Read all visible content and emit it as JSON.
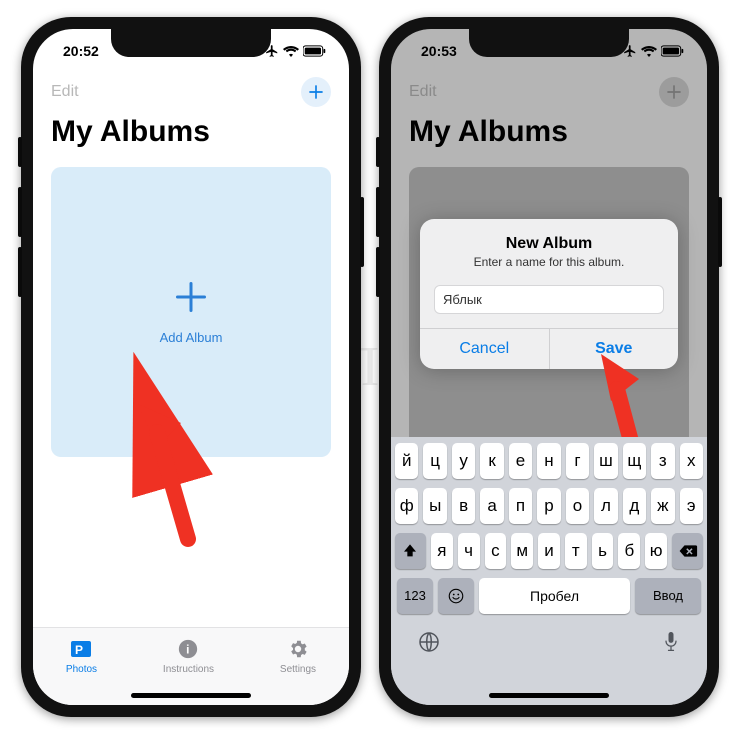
{
  "watermark": "ЯБЛЫК",
  "left": {
    "status": {
      "time": "20:52"
    },
    "nav": {
      "edit": "Edit"
    },
    "title": "My Albums",
    "card": {
      "label": "Add Album"
    },
    "tabs": {
      "photos": "Photos",
      "instructions": "Instructions",
      "settings": "Settings"
    }
  },
  "right": {
    "status": {
      "time": "20:53"
    },
    "nav": {
      "edit": "Edit"
    },
    "title": "My Albums",
    "dialog": {
      "title": "New Album",
      "subtitle": "Enter a name for this album.",
      "value": "Яблык",
      "cancel": "Cancel",
      "save": "Save"
    },
    "keyboard": {
      "row1": [
        "й",
        "ц",
        "у",
        "к",
        "е",
        "н",
        "г",
        "ш",
        "щ",
        "з",
        "х"
      ],
      "row2": [
        "ф",
        "ы",
        "в",
        "а",
        "п",
        "р",
        "о",
        "л",
        "д",
        "ж",
        "э"
      ],
      "row3": [
        "я",
        "ч",
        "с",
        "м",
        "и",
        "т",
        "ь",
        "б",
        "ю"
      ],
      "num": "123",
      "space": "Пробел",
      "enter": "Ввод"
    }
  }
}
